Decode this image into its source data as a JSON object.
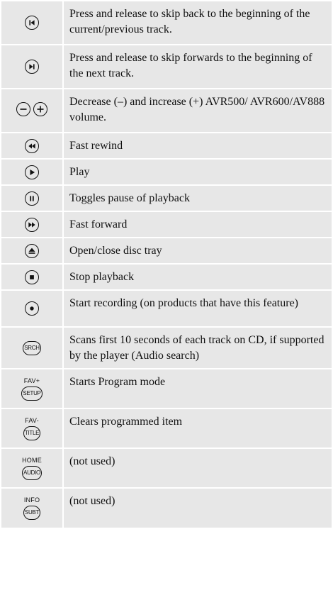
{
  "rows": [
    {
      "icon": "skip-back-icon",
      "desc": "Press and release to skip back to the beginning of the current/previous track."
    },
    {
      "icon": "skip-forward-icon",
      "desc": "Press and release to skip forwards to the beginning of the next track."
    },
    {
      "icon": "volume-minus-plus-icon",
      "desc": "Decrease (–) and increase (+) AVR500/ AVR600/AV888 volume."
    },
    {
      "icon": "fast-rewind-icon",
      "desc": "Fast rewind"
    },
    {
      "icon": "play-icon",
      "desc": "Play"
    },
    {
      "icon": "pause-icon",
      "desc": "Toggles pause of playback"
    },
    {
      "icon": "fast-forward-icon",
      "desc": "Fast forward"
    },
    {
      "icon": "eject-icon",
      "desc": "Open/close disc tray"
    },
    {
      "icon": "stop-icon",
      "desc": "Stop playback"
    },
    {
      "icon": "record-icon",
      "desc": "Start recording (on products that have this feature)"
    },
    {
      "icon": "search-button-icon",
      "label": "SRCH",
      "desc": "Scans first 10 seconds of each track on CD, if supported by the player (Audio search)"
    },
    {
      "icon": "setup-button-icon",
      "caption": "FAV+",
      "label": "SETUP",
      "desc": "Starts Program mode"
    },
    {
      "icon": "title-button-icon",
      "caption": "FAV-",
      "label": "TITLE",
      "desc": "Clears programmed item"
    },
    {
      "icon": "audio-button-icon",
      "caption": "HOME",
      "label": "AUDIO",
      "desc": "(not used)"
    },
    {
      "icon": "subtitle-button-icon",
      "caption": "INFO",
      "label": "SUBT",
      "desc": "(not used)"
    }
  ]
}
